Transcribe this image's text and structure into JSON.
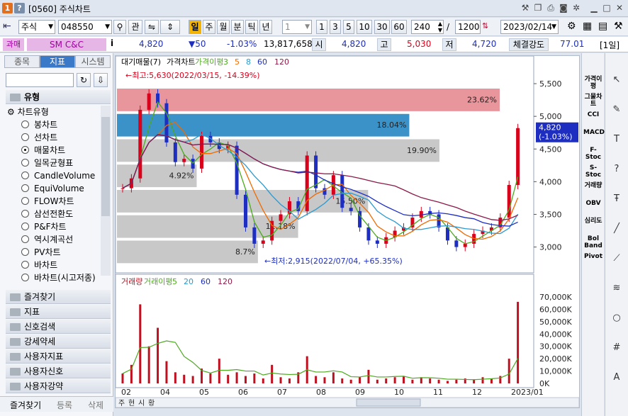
{
  "window": {
    "badge1": "1",
    "badge2": "?",
    "title": "[0560] 주식차트"
  },
  "toolbar": {
    "market": "주식",
    "code": "048550",
    "btn_gwan": "관",
    "periods": [
      "일",
      "주",
      "월",
      "분",
      "틱",
      "년"
    ],
    "period_active": "일",
    "unit": "1",
    "quick": [
      "1",
      "3",
      "5",
      "10",
      "30",
      "60"
    ],
    "count": "240",
    "total": "1200",
    "date": "2023/02/14"
  },
  "quote": {
    "badge": "과매",
    "name": "SM C&C",
    "price": "4,820",
    "change": "▼50",
    "pct": "-1.03%",
    "volume": "13,817,658",
    "open_label": "시",
    "open": "4,820",
    "high_label": "고",
    "high": "5,030",
    "low_label": "저",
    "low": "4,720",
    "strength_label": "체결강도",
    "strength": "77.01",
    "period": "[1일]"
  },
  "left": {
    "tabs": [
      "종목",
      "지표",
      "시스템"
    ],
    "active_tab": "지표",
    "section": "유형",
    "tree_root": "차트유형",
    "items": [
      "봉차트",
      "선차트",
      "매물차트",
      "일목균형표",
      "CandleVolume",
      "EquiVolume",
      "FLOW차트",
      "삼선전환도",
      "P&F차트",
      "역시계곡선",
      "PV차트",
      "바차트",
      "바차트(시고저종)"
    ],
    "selected": "매물차트",
    "categories": [
      "즐겨찾기",
      "지표",
      "신호검색",
      "강세약세",
      "사용자지표",
      "사용자신호",
      "사용자강약"
    ],
    "bottom_tabs": [
      "즐겨찾기",
      "등록",
      "삭제"
    ]
  },
  "chart_data": {
    "type": "line",
    "price_panel": {
      "legend": [
        "대기매물(7)",
        "가격차트",
        "가격이평",
        "3",
        "5",
        "8",
        "60",
        "120"
      ],
      "ylim": [
        2800,
        5750
      ],
      "yticks": [
        "5,500",
        "5,000",
        "4,500",
        "4,000",
        "3,500",
        "3,000"
      ],
      "current_price": "4,820",
      "current_pct": "(-1.03%)",
      "high_note": "←최고:5,630(2022/03/15, -14.39%)",
      "low_note": "←최저:2,915(2022/07/04, +65.35%)",
      "volume_profile": [
        {
          "label": "23.62%",
          "pct": 23.62,
          "color": "#e8959c"
        },
        {
          "label": "18.04%",
          "pct": 18.04,
          "color": "#3b92c8"
        },
        {
          "label": "19.90%",
          "pct": 19.9,
          "color": "#c8c8c8"
        },
        {
          "label": "4.92%",
          "pct": 4.92,
          "color": "#c8c8c8"
        },
        {
          "label": "15.50%",
          "pct": 15.5,
          "color": "#c8c8c8"
        },
        {
          "label": "11.18%",
          "pct": 11.18,
          "color": "#c8c8c8"
        },
        {
          "label": "8.7%",
          "pct": 8.7,
          "color": "#c8c8c8"
        }
      ],
      "close": [
        3900,
        4050,
        5100,
        5350,
        5200,
        4600,
        4300,
        4350,
        4200,
        4700,
        4600,
        4500,
        4550,
        3800,
        3300,
        3050,
        3100,
        3400,
        3500,
        3700,
        3550,
        4400,
        3900,
        3800,
        4100,
        3600,
        3550,
        3300,
        3100,
        3050,
        3150,
        3250,
        3300,
        3450,
        3550,
        3500,
        3300,
        3100,
        3000,
        3050,
        3200,
        3250,
        3300,
        3450,
        3950,
        4820
      ]
    },
    "volume_panel": {
      "legend": [
        "거래량",
        "거래이평",
        "5",
        "20",
        "60",
        "120"
      ],
      "yticks": [
        "70,000K",
        "60,000K",
        "50,000K",
        "40,000K",
        "30,000K",
        "20,000K",
        "10,000K",
        "0K"
      ],
      "ylim": [
        0,
        78000
      ],
      "values": [
        8000,
        15000,
        64000,
        30000,
        45000,
        18000,
        9000,
        7000,
        6000,
        12000,
        8000,
        20000,
        7000,
        9000,
        6000,
        8000,
        4000,
        15000,
        5000,
        4000,
        9000,
        22000,
        6000,
        5000,
        9000,
        4000,
        3000,
        5000,
        11000,
        3000,
        4000,
        5000,
        6000,
        3000,
        5000,
        4000,
        3000,
        2000,
        3000,
        4000,
        3000,
        5000,
        4000,
        6000,
        20000,
        66000
      ]
    },
    "x_ticks": [
      "02",
      "04",
      "05",
      "06",
      "07",
      "08",
      "09",
      "10",
      "11",
      "12",
      "2023/01"
    ]
  },
  "right_tools": [
    "가격이평",
    "그물차트",
    "CCI",
    "MACD",
    "F-Stoc",
    "S-Stoc",
    "거래량",
    "OBV",
    "심리도",
    "Bol Band",
    "Pivot"
  ],
  "icons": [
    "cursor-icon",
    "paint-icon",
    "text-icon",
    "question-icon",
    "font-icon",
    "line-icon",
    "trend-icon",
    "fibonacci-icon",
    "circle-icon",
    "grid-icon",
    "auto-icon"
  ],
  "bottom_chart_tabs": [
    "주",
    "현",
    "시",
    "황"
  ],
  "colors": {
    "accent": "#3a78c8",
    "down": "#1d2ec0",
    "up": "#d9001b"
  }
}
